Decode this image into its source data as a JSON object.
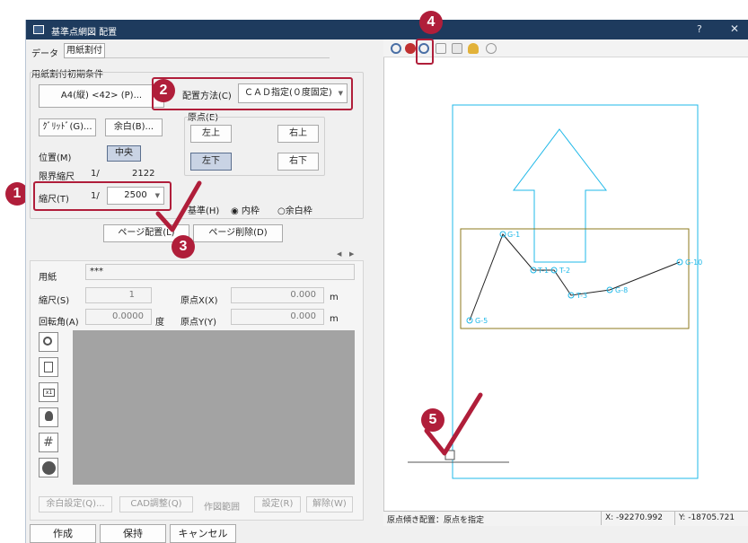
{
  "window": {
    "title": "基準点網図 配置",
    "help": "?",
    "close": "✕"
  },
  "tabs": [
    {
      "label": "データ"
    },
    {
      "label": "用紙割付"
    }
  ],
  "group_title": "用紙割付初期条件",
  "paper_button": "A4(縦) <42> (P)...",
  "layout_method": {
    "label": "配置方法(C)",
    "value": "ＣＡＤ指定(０度固定)"
  },
  "grid_button": "ｸﾞﾘｯﾄﾞ(G)...",
  "margin_button": "余白(B)...",
  "origin": {
    "label": "原点(E)",
    "top_left": "左上",
    "top_right": "右上",
    "bottom_left": "左下",
    "bottom_right": "右下"
  },
  "position": {
    "label": "位置(M)",
    "value": "中央"
  },
  "limit_scale": {
    "label": "限界縮尺",
    "prefix": "1/",
    "value": "2122"
  },
  "scale": {
    "label": "縮尺(T)",
    "prefix": "1/",
    "value": "2500"
  },
  "basis": {
    "label": "基準(H)",
    "inner": "内枠",
    "outer": "余白枠"
  },
  "page_place_button": "ページ配置(L)",
  "page_delete_button": "ページ削除(D)",
  "nav_prev": "◀",
  "nav_next": "▶",
  "paper": {
    "label": "用紙",
    "value": "***"
  },
  "scale_s": {
    "label": "縮尺(S)",
    "value": "1"
  },
  "origin_x": {
    "label": "原点X(X)",
    "value": "0.000",
    "unit": "m"
  },
  "rotation": {
    "label": "回転角(A)",
    "value": "0.0000",
    "unit": "度"
  },
  "origin_y": {
    "label": "原点Y(Y)",
    "value": "0.000",
    "unit": "m"
  },
  "bottom_buttons": {
    "margin_settings": "余白設定(Q)...",
    "cad_adjust": "CAD調整(Q)",
    "draw_range": "作図範囲",
    "set": "設定(R)",
    "cancel_set": "解除(W)"
  },
  "footer": {
    "create": "作成",
    "save": "保持",
    "cancel": "キャンセル"
  },
  "status": {
    "message": "原点傾き配置：原点を指定",
    "x": "X: -92270.992",
    "y": "Y: -18705.721"
  },
  "points": [
    {
      "label": "G-1"
    },
    {
      "label": "T-1"
    },
    {
      "label": "T-2"
    },
    {
      "label": "T-3"
    },
    {
      "label": "G-8"
    },
    {
      "label": "G-10"
    },
    {
      "label": "G-5"
    }
  ],
  "callouts": [
    "1",
    "2",
    "3",
    "4",
    "5"
  ],
  "colors": {
    "title_bar": "#1e3b5e",
    "accent_red": "#b01e3a",
    "cyan": "#1fb8e8",
    "olive": "#8e7a1c"
  }
}
